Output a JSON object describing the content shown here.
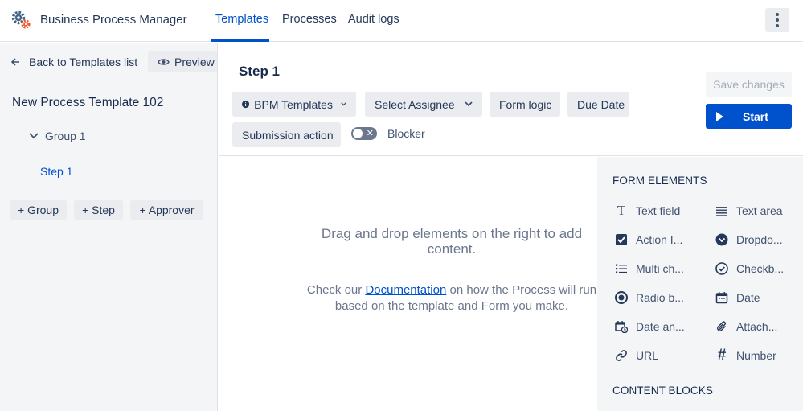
{
  "app": {
    "title": "Business Process Manager"
  },
  "nav": {
    "tabs": [
      "Templates",
      "Processes",
      "Audit logs"
    ]
  },
  "sidebar": {
    "back_label": "Back to Templates list",
    "preview_label": "Preview",
    "template_name": "New Process Template 102",
    "group_label": "Group 1",
    "step_label": "Step 1",
    "buttons": [
      "+ Group",
      "+ Step",
      "+ Approver"
    ]
  },
  "editor": {
    "step_title": "Step 1",
    "toolbar": {
      "bpm_templates": "BPM Templates",
      "select_assignee": "Select Assignee",
      "form_logic": "Form logic",
      "due_date": "Due Date",
      "submission_action": "Submission action",
      "blocker": "Blocker"
    },
    "save_label": "Save changes",
    "start_label": "Start"
  },
  "canvas": {
    "drop_text": "Drag and drop elements on the right to add content.",
    "doc_prefix": "Check our",
    "doc_link": "Documentation",
    "doc_suffix": "on how the Process will run based on the template and Form you make."
  },
  "panel": {
    "form_heading": "FORM ELEMENTS",
    "content_heading": "CONTENT BLOCKS",
    "elements": [
      {
        "label": "Text field",
        "icon": "text-field-icon"
      },
      {
        "label": "Text area",
        "icon": "text-area-icon"
      },
      {
        "label": "Action I...",
        "icon": "checkbox-checked-icon"
      },
      {
        "label": "Dropdo...",
        "icon": "dropdown-circle-icon"
      },
      {
        "label": "Multi ch...",
        "icon": "list-icon"
      },
      {
        "label": "Checkb...",
        "icon": "check-circle-icon"
      },
      {
        "label": "Radio b...",
        "icon": "radio-icon"
      },
      {
        "label": "Date",
        "icon": "calendar-icon"
      },
      {
        "label": "Date an...",
        "icon": "calendar-clock-icon"
      },
      {
        "label": "Attach...",
        "icon": "paperclip-icon"
      },
      {
        "label": "URL",
        "icon": "link-icon"
      },
      {
        "label": "Number",
        "icon": "hash-icon"
      }
    ]
  },
  "colors": {
    "primary": "#0052cc",
    "sidebar_bg": "#f4f5f7",
    "button_bg": "#ebecf0"
  }
}
